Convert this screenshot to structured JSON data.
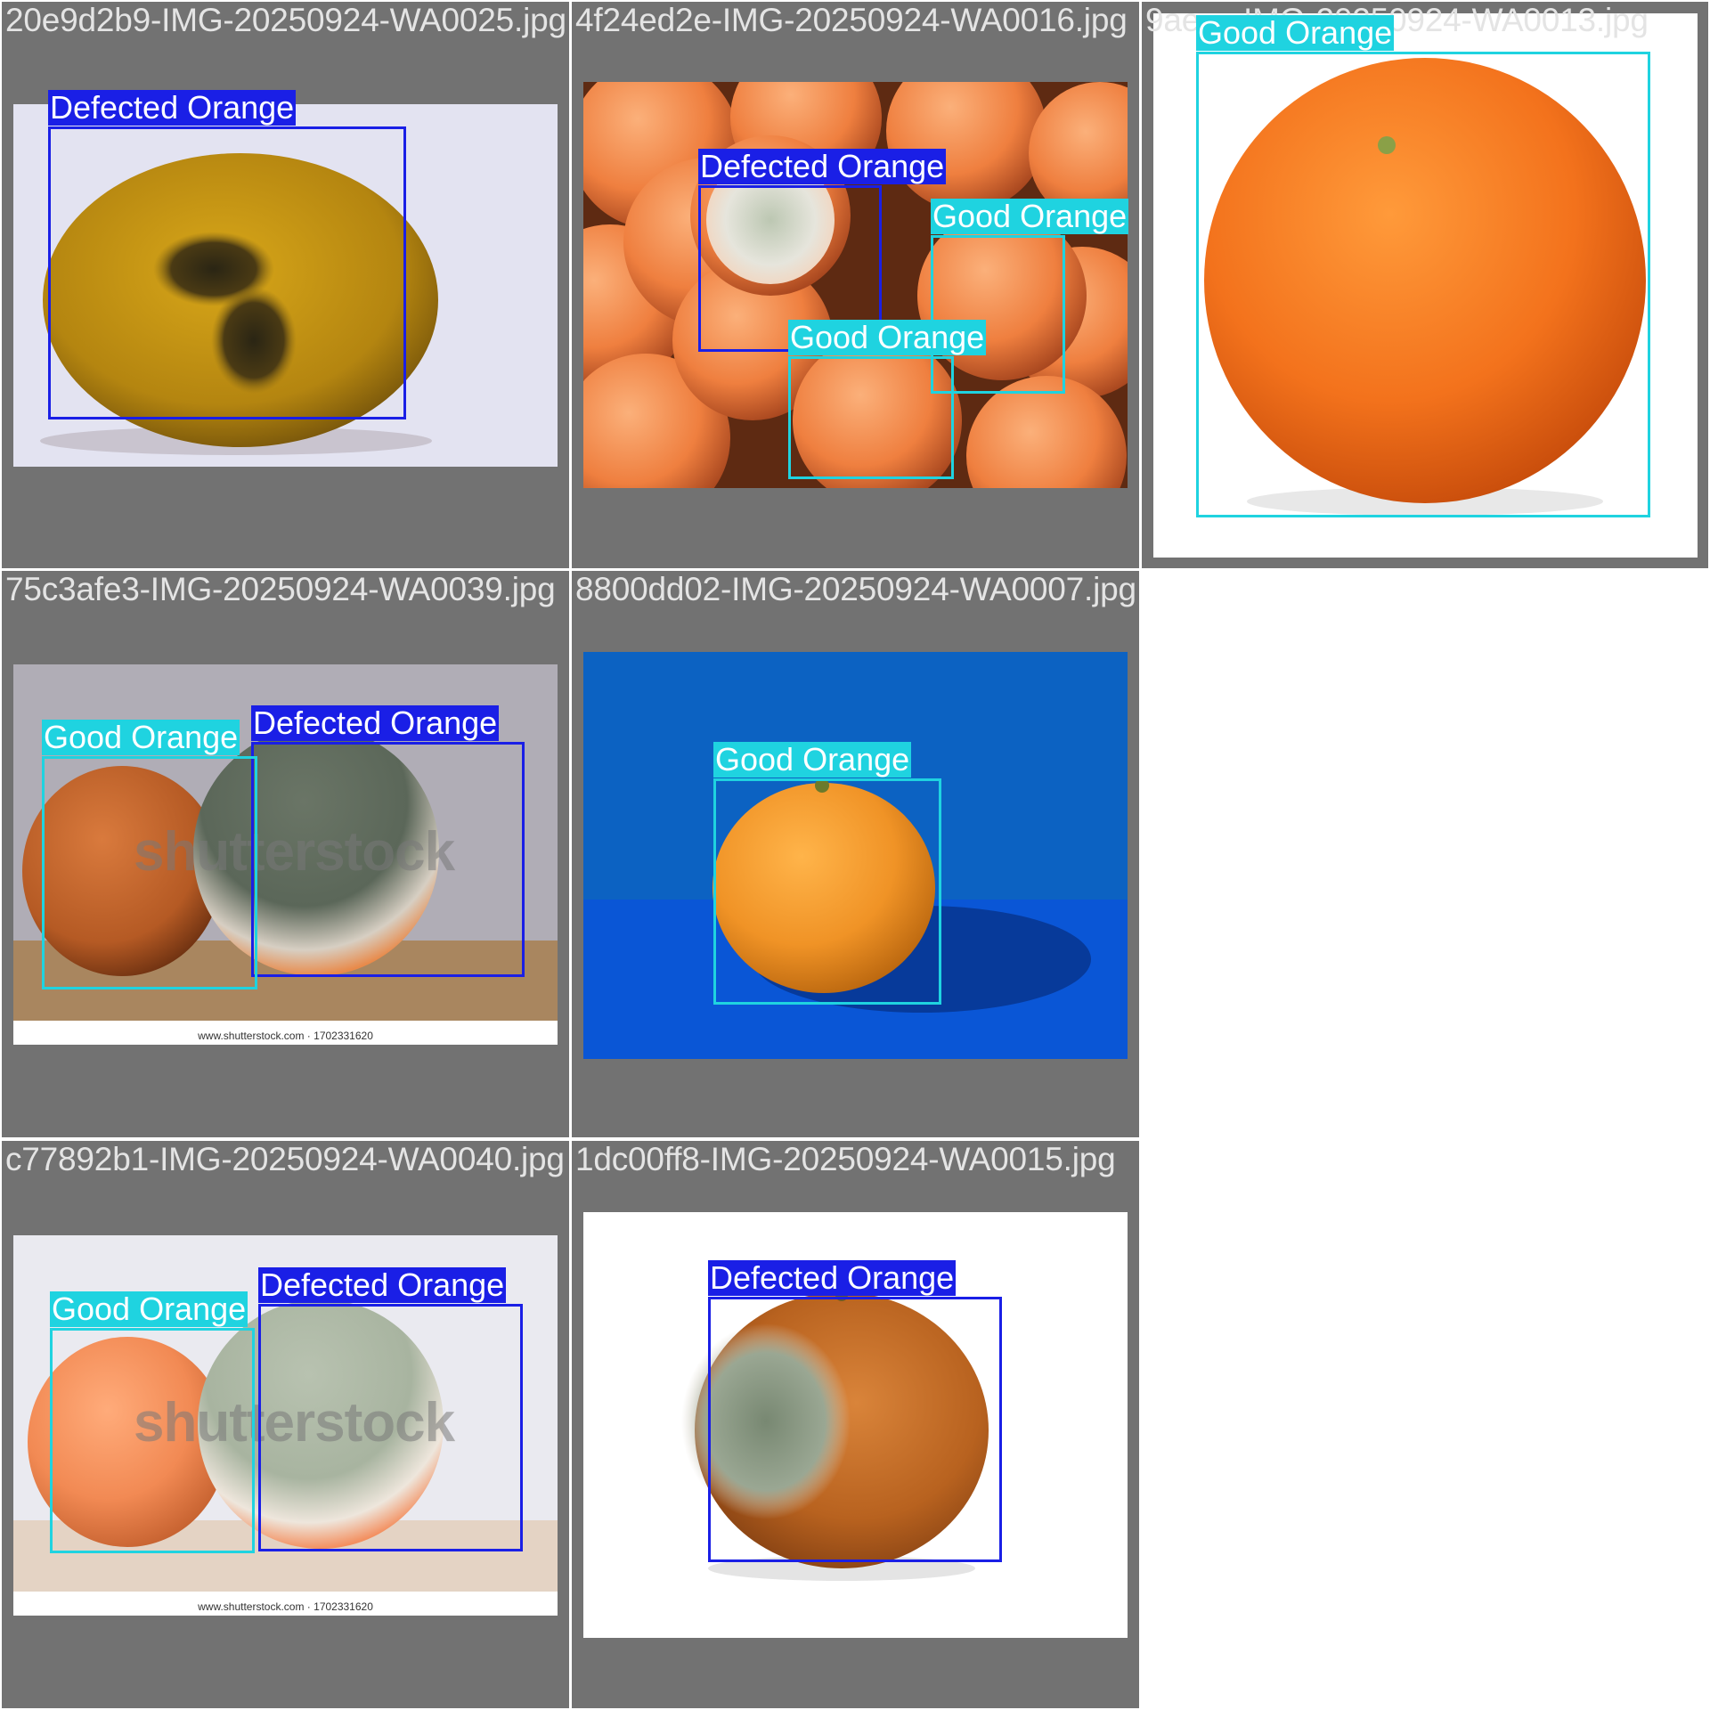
{
  "tiles": [
    {
      "filename": "20e9d2b9-IMG-20250924-WA0025.jpg",
      "detections": [
        {
          "label": "Defected Orange",
          "class": "defect"
        }
      ]
    },
    {
      "filename": "4f24ed2e-IMG-20250924-WA0016.jpg",
      "detections": [
        {
          "label": "Defected Orange",
          "class": "defect"
        },
        {
          "label": "Good Orange",
          "class": "good"
        },
        {
          "label": "Good Orange",
          "class": "good"
        }
      ]
    },
    {
      "filename": "9ae…-IMG-20250924-WA0013.jpg",
      "detections": [
        {
          "label": "Good Orange",
          "class": "good"
        }
      ]
    },
    {
      "filename": "75c3afe3-IMG-20250924-WA0039.jpg",
      "watermark": "shutterstock",
      "credit": "www.shutterstock.com · 1702331620",
      "detections": [
        {
          "label": "Good Orange",
          "class": "good"
        },
        {
          "label": "Defected Orange",
          "class": "defect"
        }
      ]
    },
    {
      "filename": "8800dd02-IMG-20250924-WA0007.jpg",
      "detections": [
        {
          "label": "Good Orange",
          "class": "good"
        }
      ]
    },
    {
      "filename": "c77892b1-IMG-20250924-WA0040.jpg",
      "watermark": "shutterstock",
      "credit": "www.shutterstock.com · 1702331620",
      "detections": [
        {
          "label": "Good Orange",
          "class": "good"
        },
        {
          "label": "Defected Orange",
          "class": "defect"
        }
      ]
    },
    {
      "filename": "1dc00ff8-IMG-20250924-WA0015.jpg",
      "detections": [
        {
          "label": "Defected Orange",
          "class": "defect"
        }
      ]
    }
  ],
  "colors": {
    "good": "#1fd3e0",
    "defect": "#1a1fe6",
    "tile_bg": "#727272"
  }
}
